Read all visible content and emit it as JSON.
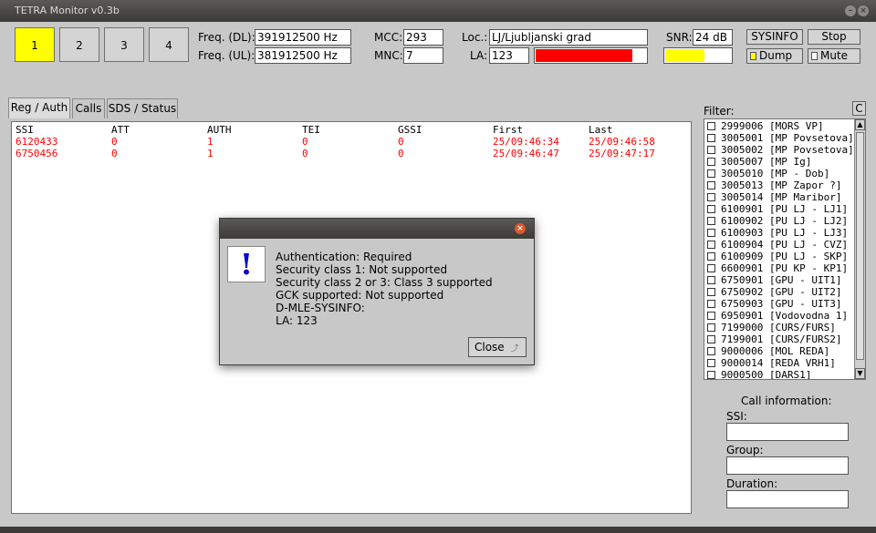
{
  "window": {
    "title": "TETRA Monitor v0.3b"
  },
  "channels": [
    {
      "label": "1",
      "active": true
    },
    {
      "label": "2",
      "active": false
    },
    {
      "label": "3",
      "active": false
    },
    {
      "label": "4",
      "active": false
    }
  ],
  "freq": {
    "dl_label": "Freq. (DL):",
    "dl_value": "391912500 Hz",
    "ul_label": "Freq. (UL):",
    "ul_value": "381912500 Hz"
  },
  "net": {
    "mcc_label": "MCC:",
    "mcc_value": "293",
    "mnc_label": "MNC:",
    "mnc_value": "7"
  },
  "location": {
    "loc_label": "Loc.:",
    "loc_value": "LJ/Ljubljanski grad",
    "la_label": "LA:",
    "la_value": "123",
    "signal_bar_fraction": 0.88,
    "signal_color": "#ff0000"
  },
  "snr": {
    "label": "SNR:",
    "value": "24 dB",
    "bar_fraction": 0.6,
    "bar_color": "#ffff00"
  },
  "controls": {
    "sysinfo_label": "SYSINFO",
    "stop_label": "Stop",
    "dump_label": "Dump",
    "mute_label": "Mute",
    "dump_checked": true,
    "mute_checked": false
  },
  "tabs": [
    {
      "label": "Reg / Auth",
      "active": true
    },
    {
      "label": "Calls",
      "active": false
    },
    {
      "label": "SDS / Status",
      "active": false
    }
  ],
  "table": {
    "headers": [
      "SSI",
      "ATT",
      "AUTH",
      "TEI",
      "GSSI",
      "First",
      "Last"
    ],
    "rows": [
      [
        "6120433",
        "0",
        "1",
        "0",
        "0",
        "25/09:46:34",
        "25/09:46:58"
      ],
      [
        "6750456",
        "0",
        "1",
        "0",
        "0",
        "25/09:46:47",
        "25/09:47:17"
      ]
    ],
    "row_color": "#ff0000"
  },
  "filter": {
    "label": "Filter:",
    "clear_label": "C",
    "items": [
      "2999006 [MORS VP]",
      "3005001 [MP Povsetova]",
      "3005002 [MP Povsetova]",
      "3005007 [MP Ig]",
      "3005010 [MP - Dob]",
      "3005013 [MP Zapor ?]",
      "3005014 [MP Maribor]",
      "6100901 [PU LJ - LJ1]",
      "6100902 [PU LJ - LJ2]",
      "6100903 [PU LJ - LJ3]",
      "6100904 [PU LJ - CVZ]",
      "6100909 [PU LJ - SKP]",
      "6600901 [PU KP - KP1]",
      "6750901 [GPU - UIT1]",
      "6750902 [GPU - UIT2]",
      "6750903 [GPU - UIT3]",
      "6950901 [Vodovodna 1]",
      "7199000 [CURS/FURS]",
      "7199001 [CURS/FURS2]",
      "9000006 [MOL REDA]",
      "9000014 [REDA VRH1]",
      "9000500 [DARS1]"
    ]
  },
  "callinfo": {
    "title": "Call information:",
    "ssi_label": "SSI:",
    "group_label": "Group:",
    "duration_label": "Duration:"
  },
  "dialog": {
    "icon": "exclamation-icon",
    "lines": [
      "Authentication: Required",
      "Security class 1: Not supported",
      "Security class 2 or 3: Class 3 supported",
      "GCK supported: Not supported",
      "D-MLE-SYSINFO:",
      "LA: 123"
    ],
    "close_label": "Close"
  }
}
